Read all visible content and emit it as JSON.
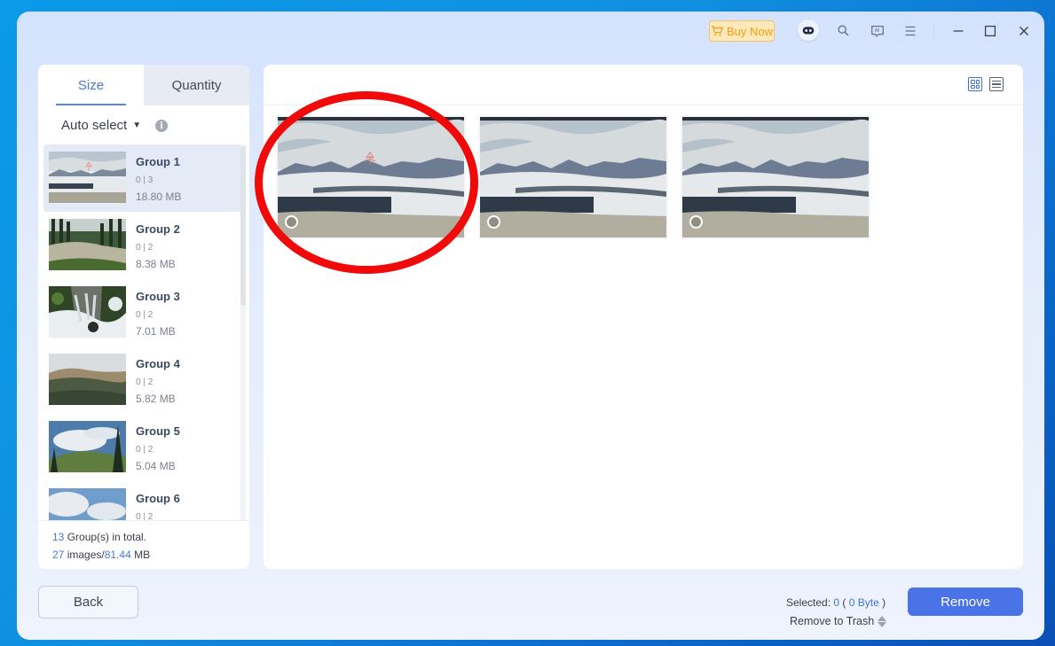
{
  "titlebar": {
    "buy_now_label": "Buy Now",
    "icons": [
      "robot-assistant-icon",
      "search-icon",
      "feedback-icon",
      "menu-icon",
      "minimize-icon",
      "maximize-icon",
      "close-icon"
    ]
  },
  "left_panel": {
    "tabs": [
      {
        "label": "Size",
        "active": true
      },
      {
        "label": "Quantity",
        "active": false
      }
    ],
    "auto_select_label": "Auto select",
    "info_icon": "i",
    "groups": [
      {
        "name": "Group 1",
        "count": "0 | 3",
        "size": "18.80 MB",
        "selected": true,
        "thumb": "snowy-mountain"
      },
      {
        "name": "Group 2",
        "count": "0 | 2",
        "size": "8.38 MB",
        "selected": false,
        "thumb": "forest-rocks"
      },
      {
        "name": "Group 3",
        "count": "0 | 2",
        "size": "7.01 MB",
        "selected": false,
        "thumb": "waterfall"
      },
      {
        "name": "Group 4",
        "count": "0 | 2",
        "size": "5.82 MB",
        "selected": false,
        "thumb": "mountain-valley"
      },
      {
        "name": "Group 5",
        "count": "0 | 2",
        "size": "5.04 MB",
        "selected": false,
        "thumb": "sky-hills"
      },
      {
        "name": "Group 6",
        "count": "0 | 2",
        "size": "",
        "selected": false,
        "thumb": "sky-clouds"
      }
    ],
    "summary": {
      "groups_total": "13",
      "groups_text": " Group(s) in total.",
      "images_total": "27",
      "images_text": " images/",
      "size_total": "81.44",
      "size_unit": " MB"
    }
  },
  "right_panel": {
    "view_modes": [
      "grid-view",
      "list-view"
    ],
    "active_view": "grid-view",
    "images": [
      {
        "name": "snowy-mountain-1",
        "selected": false,
        "annotated": true
      },
      {
        "name": "snowy-mountain-2",
        "selected": false,
        "annotated": false
      },
      {
        "name": "snowy-mountain-3",
        "selected": false,
        "annotated": false
      }
    ]
  },
  "bottom_bar": {
    "back_label": "Back",
    "selected_prefix": "Selected: ",
    "selected_count": "0",
    "selected_open": " ( ",
    "selected_bytes": "0 Byte",
    "selected_close": " )",
    "remove_mode": "Remove to Trash",
    "remove_label": "Remove"
  },
  "colors": {
    "accent": "#4a73e8",
    "highlight_text": "#3f73d9",
    "buy_now": "#f0a019",
    "annotation_red": "#f00a0a"
  }
}
